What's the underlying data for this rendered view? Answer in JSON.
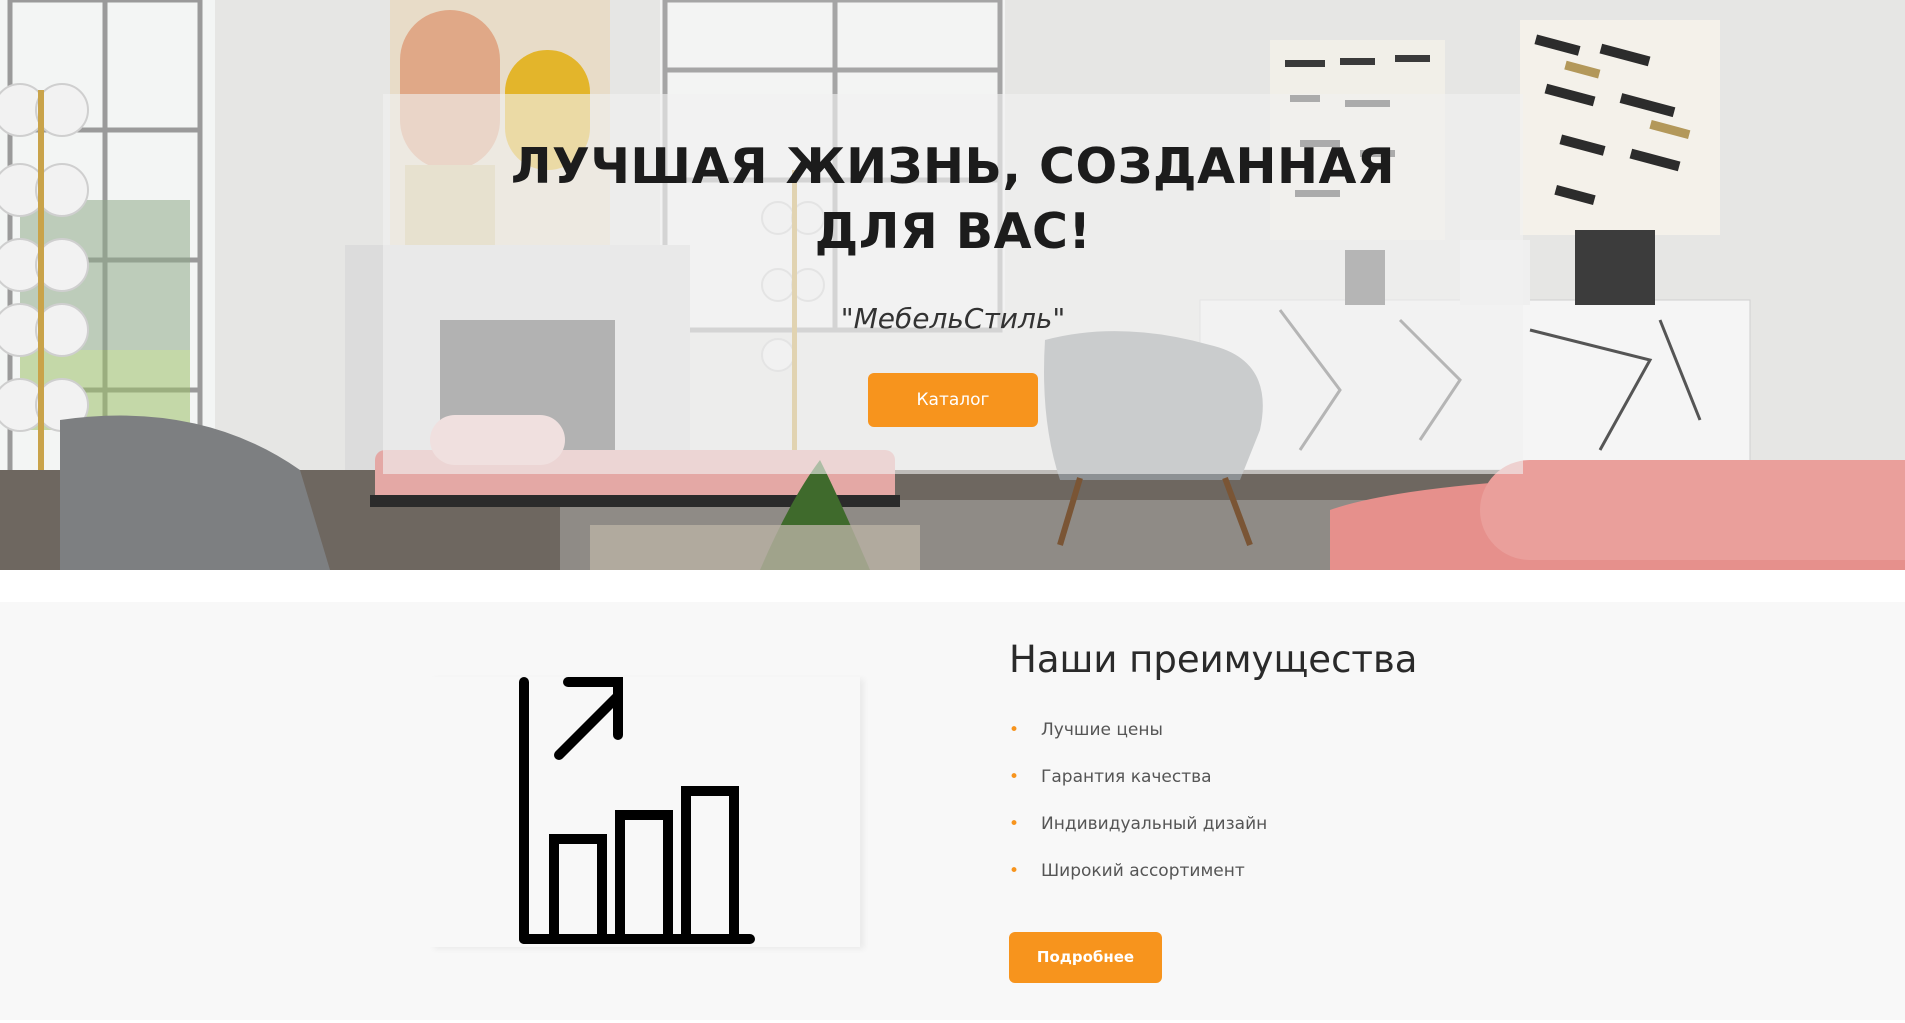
{
  "hero": {
    "title": "ЛУЧШАЯ ЖИЗНЬ, СОЗДАННАЯ ДЛЯ ВАС!",
    "subtitle": "\"МебельСтиль\"",
    "catalog_button": "Каталог",
    "background_image": "living-room-interior-photo"
  },
  "advantages": {
    "icon": "growth-chart-icon",
    "title": "Наши преимущества",
    "bullet_char": "•",
    "items": [
      {
        "label": "Лучшие цены"
      },
      {
        "label": "Гарантия качества"
      },
      {
        "label": "Индивидуальный дизайн"
      },
      {
        "label": "Широкий ассортимент"
      }
    ],
    "more_button": "Подробнее"
  },
  "colors": {
    "accent": "#f7941d",
    "section_background": "#f8f8f8",
    "text_dark": "#1c1c1c",
    "text_muted": "#555555"
  }
}
